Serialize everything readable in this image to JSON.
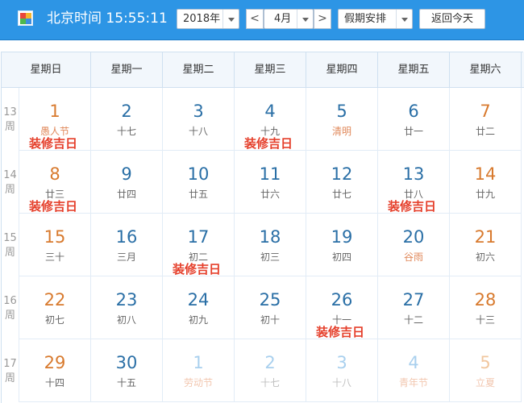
{
  "header": {
    "clock": "北京时间 15:55:11",
    "year": "2018年",
    "month": "4月",
    "holiday": "假期安排",
    "prev": "<",
    "next": ">",
    "today": "返回今天"
  },
  "weekdays": [
    "星期日",
    "星期一",
    "星期二",
    "星期三",
    "星期四",
    "星期五",
    "星期六"
  ],
  "weeks": [
    {
      "label": "13周",
      "days": [
        {
          "num": "1",
          "lunar": "愚人节",
          "festival": true,
          "weekend": true,
          "other": false,
          "note": "装修吉日"
        },
        {
          "num": "2",
          "lunar": "十七",
          "festival": false,
          "weekend": false,
          "other": false,
          "note": ""
        },
        {
          "num": "3",
          "lunar": "十八",
          "festival": false,
          "weekend": false,
          "other": false,
          "note": ""
        },
        {
          "num": "4",
          "lunar": "十九",
          "festival": false,
          "weekend": false,
          "other": false,
          "note": "装修吉日"
        },
        {
          "num": "5",
          "lunar": "清明",
          "festival": true,
          "weekend": false,
          "other": false,
          "note": ""
        },
        {
          "num": "6",
          "lunar": "廿一",
          "festival": false,
          "weekend": false,
          "other": false,
          "note": ""
        },
        {
          "num": "7",
          "lunar": "廿二",
          "festival": false,
          "weekend": true,
          "other": false,
          "note": ""
        }
      ]
    },
    {
      "label": "14周",
      "days": [
        {
          "num": "8",
          "lunar": "廿三",
          "festival": false,
          "weekend": true,
          "other": false,
          "note": "装修吉日"
        },
        {
          "num": "9",
          "lunar": "廿四",
          "festival": false,
          "weekend": false,
          "other": false,
          "note": ""
        },
        {
          "num": "10",
          "lunar": "廿五",
          "festival": false,
          "weekend": false,
          "other": false,
          "note": ""
        },
        {
          "num": "11",
          "lunar": "廿六",
          "festival": false,
          "weekend": false,
          "other": false,
          "note": ""
        },
        {
          "num": "12",
          "lunar": "廿七",
          "festival": false,
          "weekend": false,
          "other": false,
          "note": ""
        },
        {
          "num": "13",
          "lunar": "廿八",
          "festival": false,
          "weekend": false,
          "other": false,
          "note": "装修吉日"
        },
        {
          "num": "14",
          "lunar": "廿九",
          "festival": false,
          "weekend": true,
          "other": false,
          "note": ""
        }
      ]
    },
    {
      "label": "15周",
      "days": [
        {
          "num": "15",
          "lunar": "三十",
          "festival": false,
          "weekend": true,
          "other": false,
          "note": ""
        },
        {
          "num": "16",
          "lunar": "三月",
          "festival": false,
          "weekend": false,
          "other": false,
          "note": ""
        },
        {
          "num": "17",
          "lunar": "初二",
          "festival": false,
          "weekend": false,
          "other": false,
          "note": "装修吉日"
        },
        {
          "num": "18",
          "lunar": "初三",
          "festival": false,
          "weekend": false,
          "other": false,
          "note": ""
        },
        {
          "num": "19",
          "lunar": "初四",
          "festival": false,
          "weekend": false,
          "other": false,
          "note": ""
        },
        {
          "num": "20",
          "lunar": "谷雨",
          "festival": true,
          "weekend": false,
          "other": false,
          "note": ""
        },
        {
          "num": "21",
          "lunar": "初六",
          "festival": false,
          "weekend": true,
          "other": false,
          "note": ""
        }
      ]
    },
    {
      "label": "16周",
      "days": [
        {
          "num": "22",
          "lunar": "初七",
          "festival": false,
          "weekend": true,
          "other": false,
          "note": ""
        },
        {
          "num": "23",
          "lunar": "初八",
          "festival": false,
          "weekend": false,
          "other": false,
          "note": ""
        },
        {
          "num": "24",
          "lunar": "初九",
          "festival": false,
          "weekend": false,
          "other": false,
          "note": ""
        },
        {
          "num": "25",
          "lunar": "初十",
          "festival": false,
          "weekend": false,
          "other": false,
          "note": ""
        },
        {
          "num": "26",
          "lunar": "十一",
          "festival": false,
          "weekend": false,
          "other": false,
          "note": "装修吉日"
        },
        {
          "num": "27",
          "lunar": "十二",
          "festival": false,
          "weekend": false,
          "other": false,
          "note": ""
        },
        {
          "num": "28",
          "lunar": "十三",
          "festival": false,
          "weekend": true,
          "other": false,
          "note": ""
        }
      ]
    },
    {
      "label": "17周",
      "days": [
        {
          "num": "29",
          "lunar": "十四",
          "festival": false,
          "weekend": true,
          "other": false,
          "note": ""
        },
        {
          "num": "30",
          "lunar": "十五",
          "festival": false,
          "weekend": false,
          "other": false,
          "note": ""
        },
        {
          "num": "1",
          "lunar": "劳动节",
          "festival": true,
          "weekend": false,
          "other": true,
          "note": ""
        },
        {
          "num": "2",
          "lunar": "十七",
          "festival": false,
          "weekend": false,
          "other": true,
          "note": ""
        },
        {
          "num": "3",
          "lunar": "十八",
          "festival": false,
          "weekend": false,
          "other": true,
          "note": ""
        },
        {
          "num": "4",
          "lunar": "青年节",
          "festival": true,
          "weekend": false,
          "other": true,
          "note": ""
        },
        {
          "num": "5",
          "lunar": "立夏",
          "festival": true,
          "weekend": true,
          "other": true,
          "note": ""
        }
      ]
    }
  ]
}
